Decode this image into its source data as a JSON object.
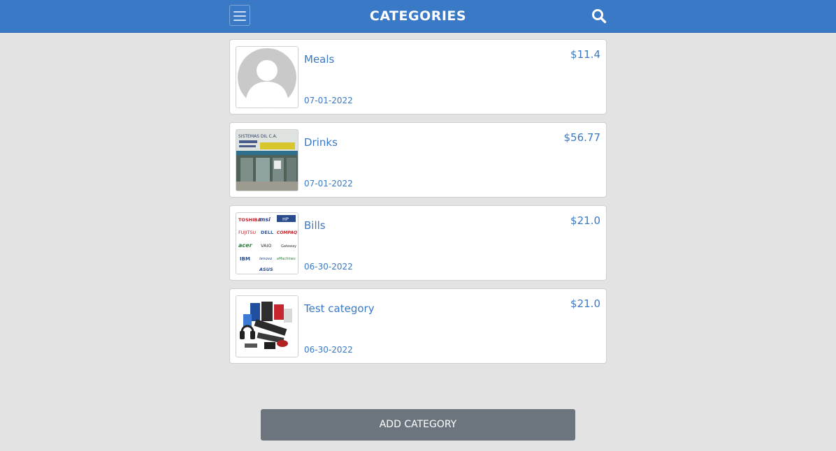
{
  "header": {
    "title": "CATEGORIES",
    "menu_icon": "hamburger-menu-icon",
    "search_icon": "search-icon",
    "background_color": "#3a79c5"
  },
  "categories": [
    {
      "name": "Meals",
      "date": "07-01-2022",
      "amount": "$11.4",
      "thumbnail": "default-avatar-image"
    },
    {
      "name": "Drinks",
      "date": "07-01-2022",
      "amount": "$56.77",
      "thumbnail": "storefront-photo"
    },
    {
      "name": "Bills",
      "date": "06-30-2022",
      "amount": "$21.0",
      "thumbnail": "laptop-brand-logos-image"
    },
    {
      "name": "Test category",
      "date": "06-30-2022",
      "amount": "$21.0",
      "thumbnail": "computer-accessories-photo"
    }
  ],
  "thumbnail_text": {
    "storefront_sign": "SISTEMAS DIL C.A.",
    "logos": [
      "TOSHIBA",
      "msi",
      "HP",
      "FUJITSU",
      "DELL",
      "COMPAQ",
      "acer",
      "VAIO",
      "Gateway",
      "IBM",
      "lenovo",
      "eMachines",
      "ASUS"
    ]
  },
  "footer": {
    "add_label": "ADD CATEGORY",
    "button_color": "#6c757d"
  },
  "accent_color": "#3a79c5"
}
